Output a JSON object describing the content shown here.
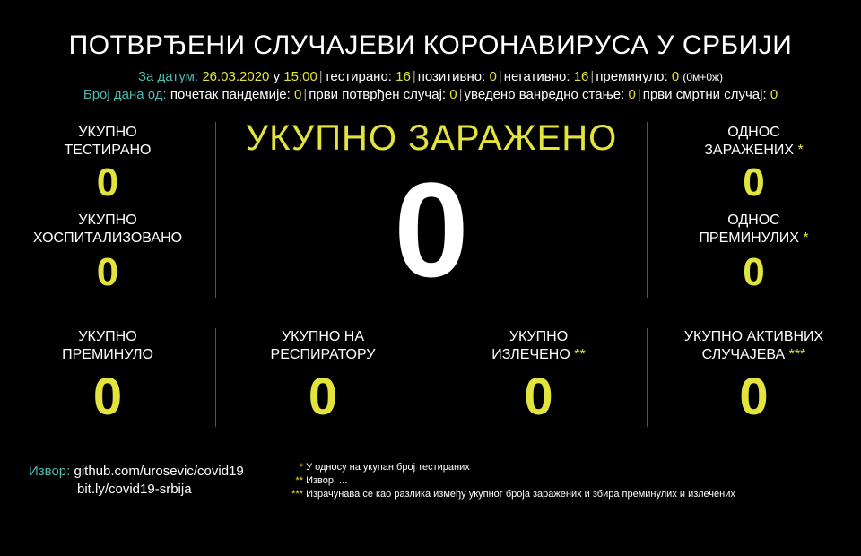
{
  "title": "ПОТВРЂЕНИ СЛУЧАЈЕВИ КОРОНАВИРУСА У СРБИЈИ",
  "info_line1": {
    "date_label": "За датум:",
    "date_value": "26.03.2020",
    "at": "у",
    "time_value": "15:00",
    "tested_label": "тестирано:",
    "tested_value": "16",
    "positive_label": "позитивно:",
    "positive_value": "0",
    "negative_label": "негативно:",
    "negative_value": "16",
    "deceased_label": "преминуло:",
    "deceased_value": "0",
    "deceased_detail": "(0м+0ж)"
  },
  "info_line2": {
    "days_label": "Број дана од:",
    "pandemic_label": "почетак пандемије:",
    "pandemic_value": "0",
    "first_case_label": "први потврђен случај:",
    "first_case_value": "0",
    "emergency_label": "уведено ванредно стање:",
    "emergency_value": "0",
    "first_death_label": "први смртни случај:",
    "first_death_value": "0"
  },
  "stats": {
    "total_tested": {
      "line1": "УКУПНО",
      "line2": "ТЕСТИРАНО",
      "value": "0"
    },
    "total_hospitalized": {
      "line1": "УКУПНО",
      "line2": "ХОСПИТАЛИЗОВАНО",
      "value": "0"
    },
    "total_infected": {
      "label": "УКУПНО ЗАРАЖЕНО",
      "value": "0"
    },
    "infected_ratio": {
      "line1": "ОДНОС",
      "line2": "ЗАРАЖЕНИХ",
      "mark": "*",
      "value": "0"
    },
    "deceased_ratio": {
      "line1": "ОДНОС",
      "line2": "ПРЕМИНУЛИХ",
      "mark": "*",
      "value": "0"
    },
    "total_deceased": {
      "line1": "УКУПНО",
      "line2": "ПРЕМИНУЛО",
      "value": "0"
    },
    "on_respirator": {
      "line1": "УКУПНО НА",
      "line2": "РЕСПИРАТОРУ",
      "value": "0"
    },
    "recovered": {
      "line1": "УКУПНО",
      "line2": "ИЗЛЕЧЕНО",
      "mark": "**",
      "value": "0"
    },
    "active": {
      "line1": "УКУПНО АКТИВНИХ",
      "line2": "СЛУЧАЈЕВА",
      "mark": "***",
      "value": "0"
    }
  },
  "source": {
    "label": "Извор:",
    "link1": "github.com/urosevic/covid19",
    "link2": "bit.ly/covid19-srbija"
  },
  "notes": [
    {
      "mark": "*",
      "text": "У односу на укупан број тестираних"
    },
    {
      "mark": "**",
      "text": "Извор: ..."
    },
    {
      "mark": "***",
      "text": "Израчунава се као разлика између укупног броја заражених и збира преминулих и излечених"
    }
  ],
  "colors": {
    "accent": "#e2e33c",
    "teal": "#4dbbb0",
    "background": "#000000",
    "separator": "#555555"
  }
}
